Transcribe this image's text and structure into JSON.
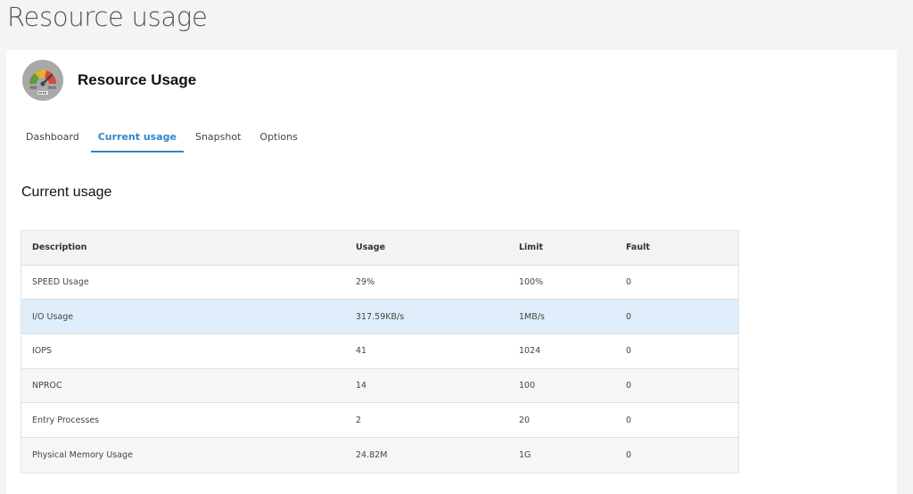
{
  "page": {
    "heading": "Resource usage"
  },
  "app": {
    "title": "Resource Usage",
    "logo_icon": "gauge-icon",
    "logo_labels": {
      "min": "MIN",
      "max": "MAX"
    }
  },
  "tabs": [
    {
      "label": "Dashboard",
      "active": false
    },
    {
      "label": "Current usage",
      "active": true
    },
    {
      "label": "Snapshot",
      "active": false
    },
    {
      "label": "Options",
      "active": false
    }
  ],
  "section": {
    "title": "Current usage"
  },
  "table": {
    "headers": [
      "Description",
      "Usage",
      "Limit",
      "Fault"
    ],
    "rows": [
      [
        "SPEED Usage",
        "29%",
        "100%",
        "0"
      ],
      [
        "I/O Usage",
        "317.59KB/s",
        "1MB/s",
        "0"
      ],
      [
        "IOPS",
        "41",
        "1024",
        "0"
      ],
      [
        "NPROC",
        "14",
        "100",
        "0"
      ],
      [
        "Entry Processes",
        "2",
        "20",
        "0"
      ],
      [
        "Physical Memory Usage",
        "24.82M",
        "1G",
        "0"
      ]
    ],
    "highlighted_row": 1
  },
  "colors": {
    "accent": "#2f86c9",
    "highlight_row": "#dfeefa"
  }
}
